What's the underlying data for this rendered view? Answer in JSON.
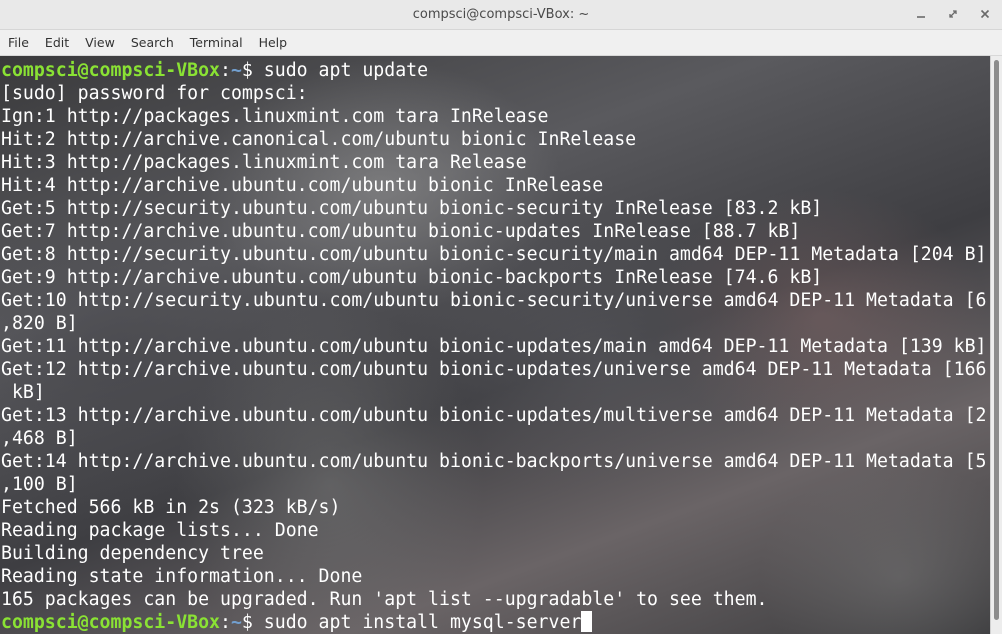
{
  "window": {
    "title": "compsci@compsci-VBox: ~",
    "controls": {
      "minimize": "minimize-icon",
      "maximize": "maximize-icon",
      "close": "close-icon"
    }
  },
  "menu": {
    "items": [
      "File",
      "Edit",
      "View",
      "Search",
      "Terminal",
      "Help"
    ]
  },
  "colors": {
    "prompt_user": "#8ae234",
    "prompt_path": "#729fcf",
    "text": "#ffffff"
  },
  "terminal": {
    "lines": [
      {
        "type": "prompt",
        "user": "compsci@compsci-VBox",
        "sep": ":",
        "path": "~",
        "symbol": "$",
        "command": " sudo apt update"
      },
      {
        "type": "output",
        "text": "[sudo] password for compsci:"
      },
      {
        "type": "output",
        "text": "Ign:1 http://packages.linuxmint.com tara InRelease"
      },
      {
        "type": "output",
        "text": "Hit:2 http://archive.canonical.com/ubuntu bionic InRelease"
      },
      {
        "type": "output",
        "text": "Hit:3 http://packages.linuxmint.com tara Release"
      },
      {
        "type": "output",
        "text": "Hit:4 http://archive.ubuntu.com/ubuntu bionic InRelease"
      },
      {
        "type": "output",
        "text": "Get:5 http://security.ubuntu.com/ubuntu bionic-security InRelease [83.2 kB]"
      },
      {
        "type": "output",
        "text": "Get:7 http://archive.ubuntu.com/ubuntu bionic-updates InRelease [88.7 kB]"
      },
      {
        "type": "output",
        "text": "Get:8 http://security.ubuntu.com/ubuntu bionic-security/main amd64 DEP-11 Metadata [204 B]"
      },
      {
        "type": "output",
        "text": "Get:9 http://archive.ubuntu.com/ubuntu bionic-backports InRelease [74.6 kB]"
      },
      {
        "type": "output",
        "text": "Get:10 http://security.ubuntu.com/ubuntu bionic-security/universe amd64 DEP-11 Metadata [6"
      },
      {
        "type": "output",
        "text": ",820 B]"
      },
      {
        "type": "output",
        "text": "Get:11 http://archive.ubuntu.com/ubuntu bionic-updates/main amd64 DEP-11 Metadata [139 kB]"
      },
      {
        "type": "output",
        "text": "Get:12 http://archive.ubuntu.com/ubuntu bionic-updates/universe amd64 DEP-11 Metadata [166"
      },
      {
        "type": "output",
        "text": " kB]"
      },
      {
        "type": "output",
        "text": "Get:13 http://archive.ubuntu.com/ubuntu bionic-updates/multiverse amd64 DEP-11 Metadata [2"
      },
      {
        "type": "output",
        "text": ",468 B]"
      },
      {
        "type": "output",
        "text": "Get:14 http://archive.ubuntu.com/ubuntu bionic-backports/universe amd64 DEP-11 Metadata [5"
      },
      {
        "type": "output",
        "text": ",100 B]"
      },
      {
        "type": "output",
        "text": "Fetched 566 kB in 2s (323 kB/s)"
      },
      {
        "type": "output",
        "text": "Reading package lists... Done"
      },
      {
        "type": "output",
        "text": "Building dependency tree"
      },
      {
        "type": "output",
        "text": "Reading state information... Done"
      },
      {
        "type": "output",
        "text": "165 packages can be upgraded. Run 'apt list --upgradable' to see them."
      },
      {
        "type": "prompt",
        "user": "compsci@compsci-VBox",
        "sep": ":",
        "path": "~",
        "symbol": "$",
        "command": " sudo apt install mysql-server",
        "cursor": true
      }
    ]
  }
}
